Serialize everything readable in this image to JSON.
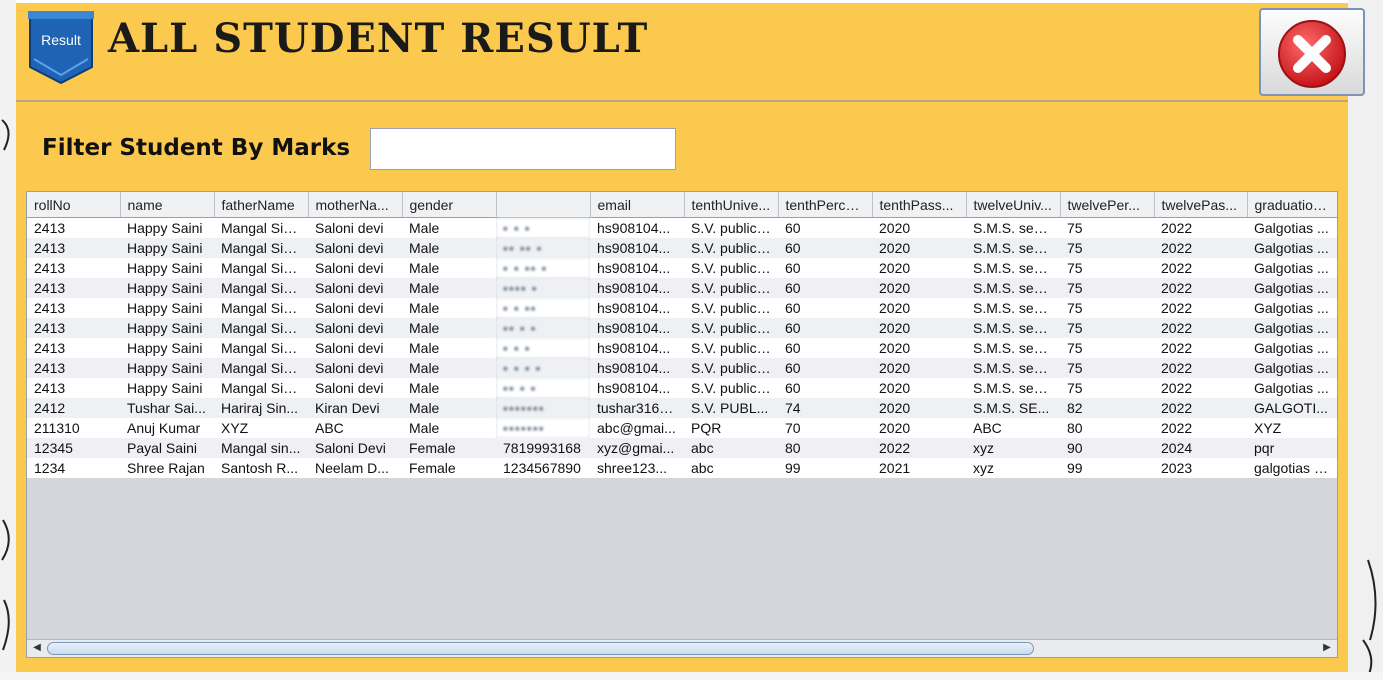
{
  "window": {
    "title": "ALL STUDENT RESULT",
    "badge_label": "Result",
    "close_icon": "close-x-icon",
    "accent_color": "#fbc94d",
    "close_color": "#e0262a"
  },
  "filter": {
    "label": "Filter Student By Marks",
    "value": "",
    "placeholder": ""
  },
  "table": {
    "columns": [
      "rollNo",
      "name",
      "fatherName",
      "motherNa...",
      "gender",
      "",
      "email",
      "tenthUnive...",
      "tenthPerce...",
      "tenthPass...",
      "twelveUniv...",
      "twelvePer...",
      "twelvePas...",
      "graduation..."
    ],
    "rows": [
      [
        "2413",
        "Happy Saini",
        "Mangal Sin...",
        "Saloni devi",
        "Male",
        "▪  ▪  ▪",
        "hs908104...",
        "S.V. public ...",
        "60",
        "2020",
        "S.M.S. sen...",
        "75",
        "2022",
        "Galgotias ..."
      ],
      [
        "2413",
        "Happy Saini",
        "Mangal Sin...",
        "Saloni devi",
        "Male",
        "▪▪ ▪▪ ▪",
        "hs908104...",
        "S.V. public ...",
        "60",
        "2020",
        "S.M.S. sen...",
        "75",
        "2022",
        "Galgotias ..."
      ],
      [
        "2413",
        "Happy Saini",
        "Mangal Sin...",
        "Saloni devi",
        "Male",
        "▪ ▪ ▪▪ ▪",
        "hs908104...",
        "S.V. public ...",
        "60",
        "2020",
        "S.M.S. sen...",
        "75",
        "2022",
        "Galgotias ..."
      ],
      [
        "2413",
        "Happy Saini",
        "Mangal Sin...",
        "Saloni devi",
        "Male",
        "▪▪▪▪ ▪",
        "hs908104...",
        "S.V. public ...",
        "60",
        "2020",
        "S.M.S. sen...",
        "75",
        "2022",
        "Galgotias ..."
      ],
      [
        "2413",
        "Happy Saini",
        "Mangal Sin...",
        "Saloni devi",
        "Male",
        "▪  ▪ ▪▪",
        "hs908104...",
        "S.V. public ...",
        "60",
        "2020",
        "S.M.S. sen...",
        "75",
        "2022",
        "Galgotias ..."
      ],
      [
        "2413",
        "Happy Saini",
        "Mangal Sin...",
        "Saloni devi",
        "Male",
        "▪▪ ▪ ▪",
        "hs908104...",
        "S.V. public ...",
        "60",
        "2020",
        "S.M.S. sen...",
        "75",
        "2022",
        "Galgotias ..."
      ],
      [
        "2413",
        "Happy Saini",
        "Mangal Sin...",
        "Saloni devi",
        "Male",
        "▪ ▪  ▪",
        "hs908104...",
        "S.V. public ...",
        "60",
        "2020",
        "S.M.S. sen...",
        "75",
        "2022",
        "Galgotias ..."
      ],
      [
        "2413",
        "Happy Saini",
        "Mangal Sin...",
        "Saloni devi",
        "Male",
        "▪ ▪ ▪ ▪",
        "hs908104...",
        "S.V. public ...",
        "60",
        "2020",
        "S.M.S. sen...",
        "75",
        "2022",
        "Galgotias ..."
      ],
      [
        "2413",
        "Happy Saini",
        "Mangal Sin...",
        "Saloni devi",
        "Male",
        "▪▪  ▪ ▪",
        "hs908104...",
        "S.V. public ...",
        "60",
        "2020",
        "S.M.S. sen...",
        "75",
        "2022",
        "Galgotias ..."
      ],
      [
        "2412",
        "Tushar Sai...",
        "Hariraj Sin...",
        "Kiran Devi",
        "Male",
        "▪▪▪▪▪▪▪",
        "tushar3168...",
        "S.V. PUBL...",
        "74",
        "2020",
        "S.M.S. SE...",
        "82",
        "2022",
        "GALGOTI..."
      ],
      [
        "211310",
        "Anuj Kumar",
        "XYZ",
        "ABC",
        "Male",
        "▪▪▪▪▪▪▪",
        "abc@gmai...",
        "PQR",
        "70",
        "2020",
        "ABC",
        "80",
        "2022",
        "XYZ"
      ],
      [
        "12345",
        "Payal Saini",
        "Mangal sin...",
        "Saloni Devi",
        "Female",
        "7819993168",
        "xyz@gmai...",
        "abc",
        "80",
        "2022",
        "xyz",
        "90",
        "2024",
        "pqr"
      ],
      [
        "1234",
        "Shree Rajan",
        "Santosh R...",
        "Neelam D...",
        "Female",
        "1234567890",
        "shree123...",
        "abc",
        "99",
        "2021",
        "xyz",
        "99",
        "2023",
        "galgotias u..."
      ]
    ],
    "redacted_rows": [
      0,
      1,
      2,
      3,
      4,
      5,
      6,
      7,
      8,
      9,
      10
    ]
  },
  "scrollbar": {
    "left_arrow": "◀",
    "right_arrow": "▶"
  }
}
